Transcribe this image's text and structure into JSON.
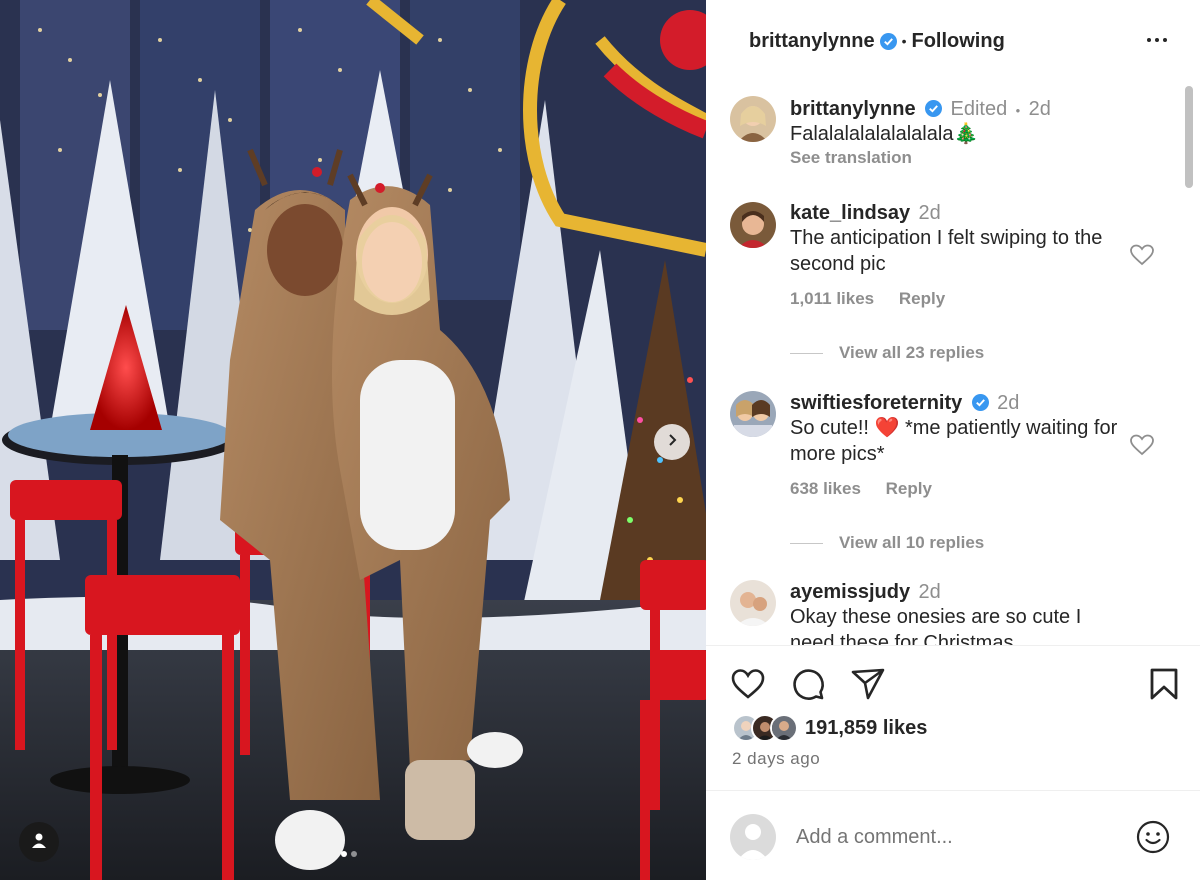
{
  "post": {
    "author": "brittanylynne",
    "follow_state": "Following",
    "separator": "•",
    "caption": {
      "username": "brittanylynne",
      "edited": "Edited",
      "dot": "•",
      "age": "2d",
      "text": "Falalalalalalalalala🎄",
      "translate": "See translation"
    }
  },
  "comments": [
    {
      "username": "kate_lindsay",
      "age": "2d",
      "text": "The anticipation I felt swiping to the second pic",
      "likes": "1,011 likes",
      "reply": "Reply",
      "view_replies": "View all 23 replies"
    },
    {
      "username": "swiftiesforeternity",
      "age": "2d",
      "text": "So cute!! ❤️ *me patiently waiting for more pics*",
      "likes": "638 likes",
      "reply": "Reply",
      "view_replies": "View all 10 replies"
    },
    {
      "username": "ayemissjudy",
      "age": "2d",
      "text": "Okay these onesies are so cute I need these for Christmas"
    }
  ],
  "engagement": {
    "likes": "191,859 likes",
    "posted": "2 days ago"
  },
  "composer": {
    "placeholder": "Add a comment..."
  },
  "icons": {
    "like": "heart-icon",
    "comment": "comment-icon",
    "share": "send-icon",
    "save": "bookmark-icon",
    "more": "more-icon",
    "next": "chevron-right-icon",
    "tags": "user-tag-icon",
    "emoji": "emoji-icon"
  },
  "colors": {
    "verified": "#3897f0",
    "text": "#262626",
    "muted": "#8e8e8e",
    "heart_red": "#e0245e"
  },
  "carousel": {
    "current": 1,
    "total": 2
  }
}
